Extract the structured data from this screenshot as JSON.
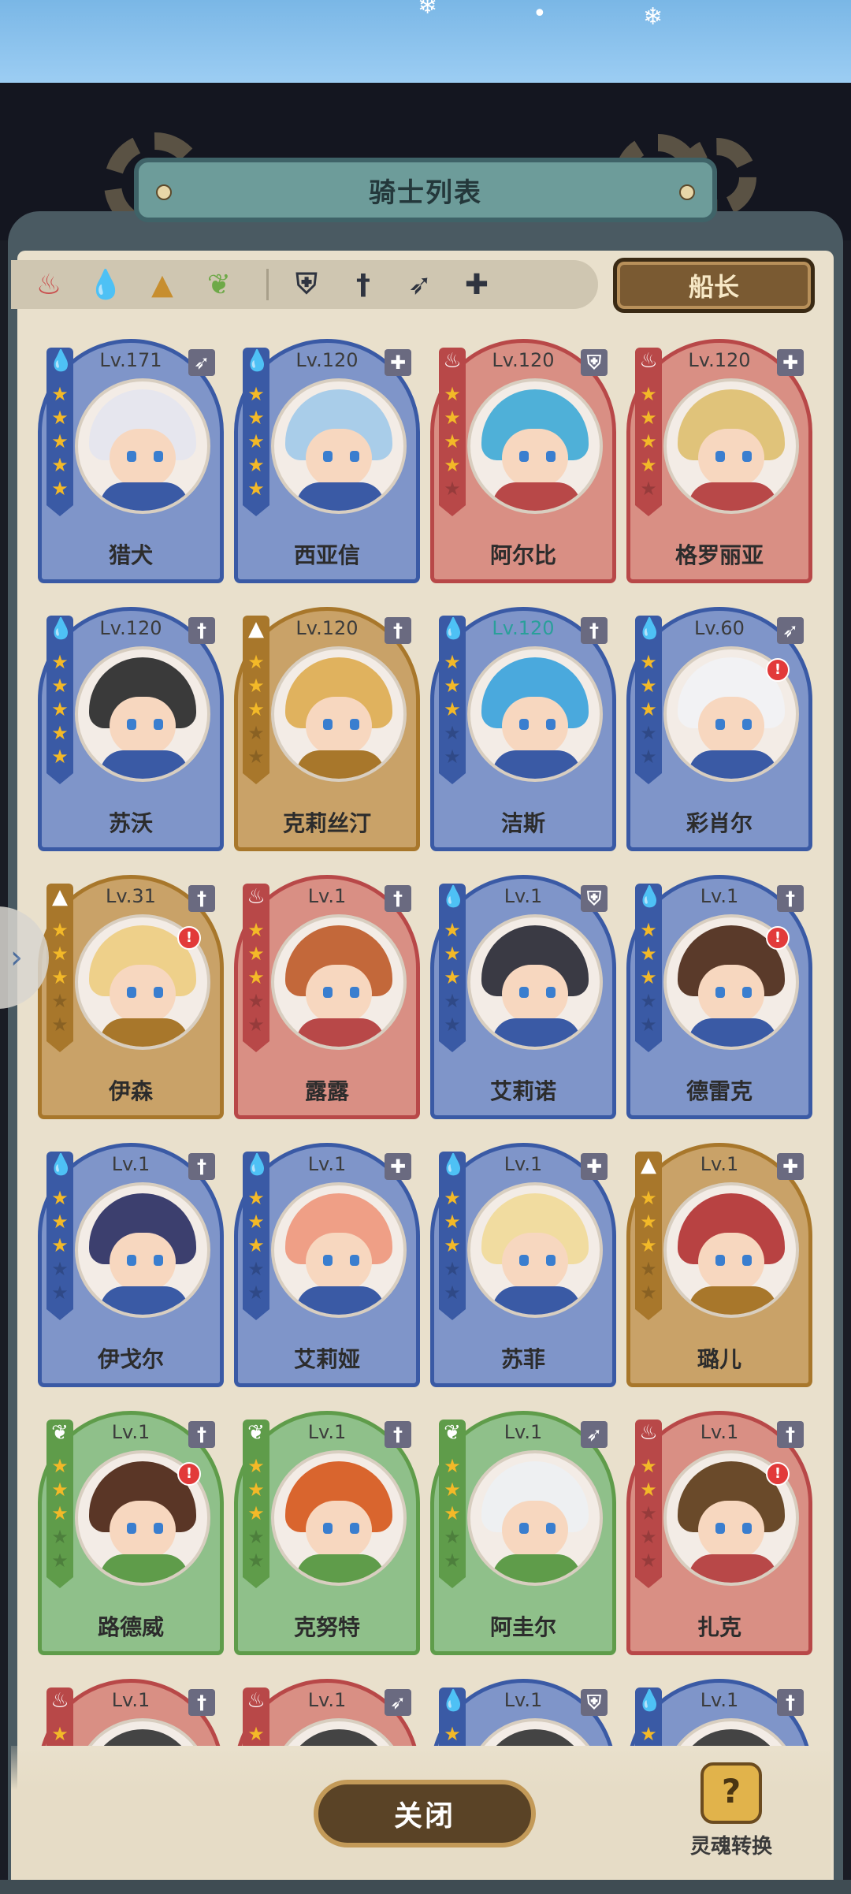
{
  "title": "骑士列表",
  "filters": {
    "elements": [
      {
        "icon": "fire-element-icon",
        "glyph": "♨",
        "color": "#c94a4a"
      },
      {
        "icon": "water-element-icon",
        "glyph": "💧",
        "color": "#3a73c9"
      },
      {
        "icon": "earth-element-icon",
        "glyph": "▲",
        "color": "#c78e2f"
      },
      {
        "icon": "wind-element-icon",
        "glyph": "❦",
        "color": "#6ea948"
      }
    ],
    "classes": [
      {
        "icon": "shield-class-icon",
        "glyph": "⛨"
      },
      {
        "icon": "sword-class-icon",
        "glyph": "†"
      },
      {
        "icon": "bow-class-icon",
        "glyph": "➶"
      },
      {
        "icon": "support-class-icon",
        "glyph": "✚"
      }
    ],
    "captain_label": "船长"
  },
  "colors": {
    "water": "#7f95c9",
    "fire": "#d98f84",
    "earth": "#c9a268",
    "wind": "#8fc08a",
    "water_ribbon": "#3a5aa5",
    "fire_ribbon": "#b84848",
    "earth_ribbon": "#a8772b",
    "wind_ribbon": "#5f9c4a"
  },
  "knights": [
    {
      "name": "猎犬",
      "level": "Lv.171",
      "element": "water",
      "class": "bow",
      "stars": 5,
      "alert": false,
      "hair": "#e6e6ee"
    },
    {
      "name": "西亚信",
      "level": "Lv.120",
      "element": "water",
      "class": "support",
      "stars": 5,
      "alert": false,
      "hair": "#a9cde9"
    },
    {
      "name": "阿尔比",
      "level": "Lv.120",
      "element": "fire",
      "class": "shield",
      "stars": 4,
      "alert": false,
      "hair": "#4fb0d8"
    },
    {
      "name": "格罗丽亚",
      "level": "Lv.120",
      "element": "fire",
      "class": "support",
      "stars": 4,
      "alert": false,
      "hair": "#e0c37a"
    },
    {
      "name": "苏沃",
      "level": "Lv.120",
      "element": "water",
      "class": "sword",
      "stars": 5,
      "alert": false,
      "hair": "#3a3a3a"
    },
    {
      "name": "克莉丝汀",
      "level": "Lv.120",
      "element": "earth",
      "class": "sword",
      "stars": 3,
      "alert": false,
      "hair": "#e0b25e"
    },
    {
      "name": "洁斯",
      "level": "Lv.120",
      "element": "water",
      "class": "sword",
      "stars": 3,
      "alert": false,
      "hair": "#4aa9dd",
      "teal": true
    },
    {
      "name": "彩肖尔",
      "level": "Lv.60",
      "element": "water",
      "class": "bow",
      "stars": 3,
      "alert": true,
      "hair": "#f2f2f4"
    },
    {
      "name": "伊森",
      "level": "Lv.31",
      "element": "earth",
      "class": "sword",
      "stars": 3,
      "alert": true,
      "hair": "#eed08a"
    },
    {
      "name": "露露",
      "level": "Lv.1",
      "element": "fire",
      "class": "sword",
      "stars": 3,
      "alert": false,
      "hair": "#c3683a"
    },
    {
      "name": "艾莉诺",
      "level": "Lv.1",
      "element": "water",
      "class": "shield",
      "stars": 3,
      "alert": false,
      "hair": "#3a3a44"
    },
    {
      "name": "德雷克",
      "level": "Lv.1",
      "element": "water",
      "class": "sword",
      "stars": 3,
      "alert": true,
      "hair": "#5a3a2a"
    },
    {
      "name": "伊戈尔",
      "level": "Lv.1",
      "element": "water",
      "class": "sword",
      "stars": 3,
      "alert": false,
      "hair": "#3c3f6e"
    },
    {
      "name": "艾莉娅",
      "level": "Lv.1",
      "element": "water",
      "class": "support",
      "stars": 3,
      "alert": false,
      "hair": "#ef9f86"
    },
    {
      "name": "苏菲",
      "level": "Lv.1",
      "element": "water",
      "class": "support",
      "stars": 3,
      "alert": false,
      "hair": "#f1dca0"
    },
    {
      "name": "璐儿",
      "level": "Lv.1",
      "element": "earth",
      "class": "support",
      "stars": 3,
      "alert": false,
      "hair": "#b84242"
    },
    {
      "name": "路德威",
      "level": "Lv.1",
      "element": "wind",
      "class": "sword",
      "stars": 3,
      "alert": true,
      "hair": "#5a3626"
    },
    {
      "name": "克努特",
      "level": "Lv.1",
      "element": "wind",
      "class": "sword",
      "stars": 3,
      "alert": false,
      "hair": "#d9652e"
    },
    {
      "name": "阿圭尔",
      "level": "Lv.1",
      "element": "wind",
      "class": "bow",
      "stars": 3,
      "alert": false,
      "hair": "#eef0f2"
    },
    {
      "name": "扎克",
      "level": "Lv.1",
      "element": "fire",
      "class": "sword",
      "stars": 2,
      "alert": true,
      "hair": "#6a4a2a"
    },
    {
      "name": "",
      "level": "Lv.1",
      "element": "fire",
      "class": "sword",
      "stars": 2,
      "alert": false,
      "hair": "#444"
    },
    {
      "name": "",
      "level": "Lv.1",
      "element": "fire",
      "class": "bow",
      "stars": 2,
      "alert": false,
      "hair": "#444"
    },
    {
      "name": "",
      "level": "Lv.1",
      "element": "water",
      "class": "shield",
      "stars": 2,
      "alert": false,
      "hair": "#444"
    },
    {
      "name": "",
      "level": "Lv.1",
      "element": "water",
      "class": "sword",
      "stars": 2,
      "alert": false,
      "hair": "#444"
    }
  ],
  "footer": {
    "close_label": "关闭",
    "soul_label": "灵魂转换",
    "soul_glyph": "?"
  }
}
